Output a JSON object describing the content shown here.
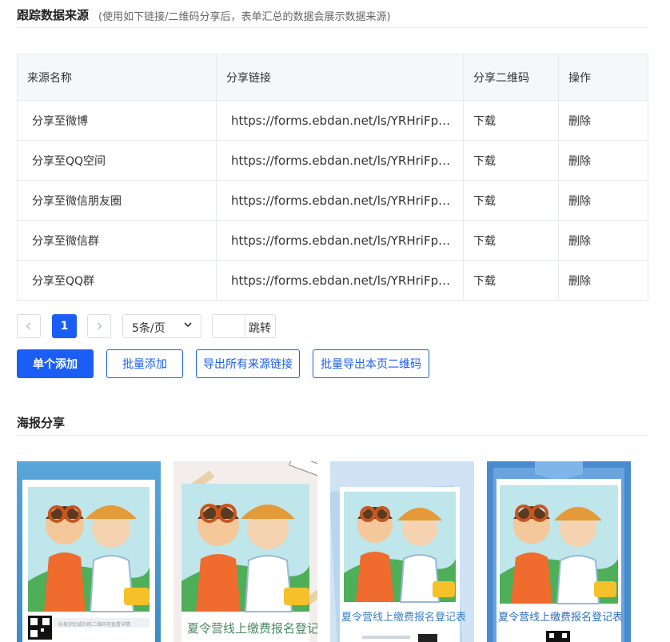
{
  "track_section": {
    "title": "跟踪数据来源",
    "hint": "(使用如下链接/二维码分享后，表单汇总的数据会展示数据来源)"
  },
  "table": {
    "headers": [
      "来源名称",
      "分享链接",
      "分享二维码",
      "操作"
    ],
    "rows": [
      {
        "name": "分享至微博",
        "link": "https://forms.ebdan.net/ls/YRHriFpo?bt...",
        "qr": "下载",
        "op": "删除"
      },
      {
        "name": "分享至QQ空间",
        "link": "https://forms.ebdan.net/ls/YRHriFpo?bt...",
        "qr": "下载",
        "op": "删除"
      },
      {
        "name": "分享至微信朋友圈",
        "link": "https://forms.ebdan.net/ls/YRHriFpo?bt...",
        "qr": "下载",
        "op": "删除"
      },
      {
        "name": "分享至微信群",
        "link": "https://forms.ebdan.net/ls/YRHriFpo?bt...",
        "qr": "下载",
        "op": "删除"
      },
      {
        "name": "分享至QQ群",
        "link": "https://forms.ebdan.net/ls/YRHriFpo?bt...",
        "qr": "下载",
        "op": "删除"
      }
    ]
  },
  "pagination": {
    "prev_icon": "chevron-left-icon",
    "next_icon": "chevron-right-icon",
    "current_page": "1",
    "page_size": "5条/页",
    "jump_value": "",
    "jump_label": "跳转"
  },
  "actions": {
    "single_add": "单个添加",
    "batch_add": "批量添加",
    "export_links": "导出所有来源链接",
    "export_qr": "批量导出本页二维码"
  },
  "poster_section": {
    "title": "海报分享"
  },
  "posters": [
    {
      "caption": "长按识别或扫码二维码可查看详情"
    },
    {
      "caption": "夏令营线上缴费报名登记表"
    },
    {
      "caption": "夏令营线上缴费报名登记表"
    },
    {
      "caption": "夏令营线上缴费报名登记表"
    }
  ],
  "colors": {
    "primary": "#1a5ef5",
    "header_bg": "#f5f8f9",
    "border": "#e7eaed"
  }
}
